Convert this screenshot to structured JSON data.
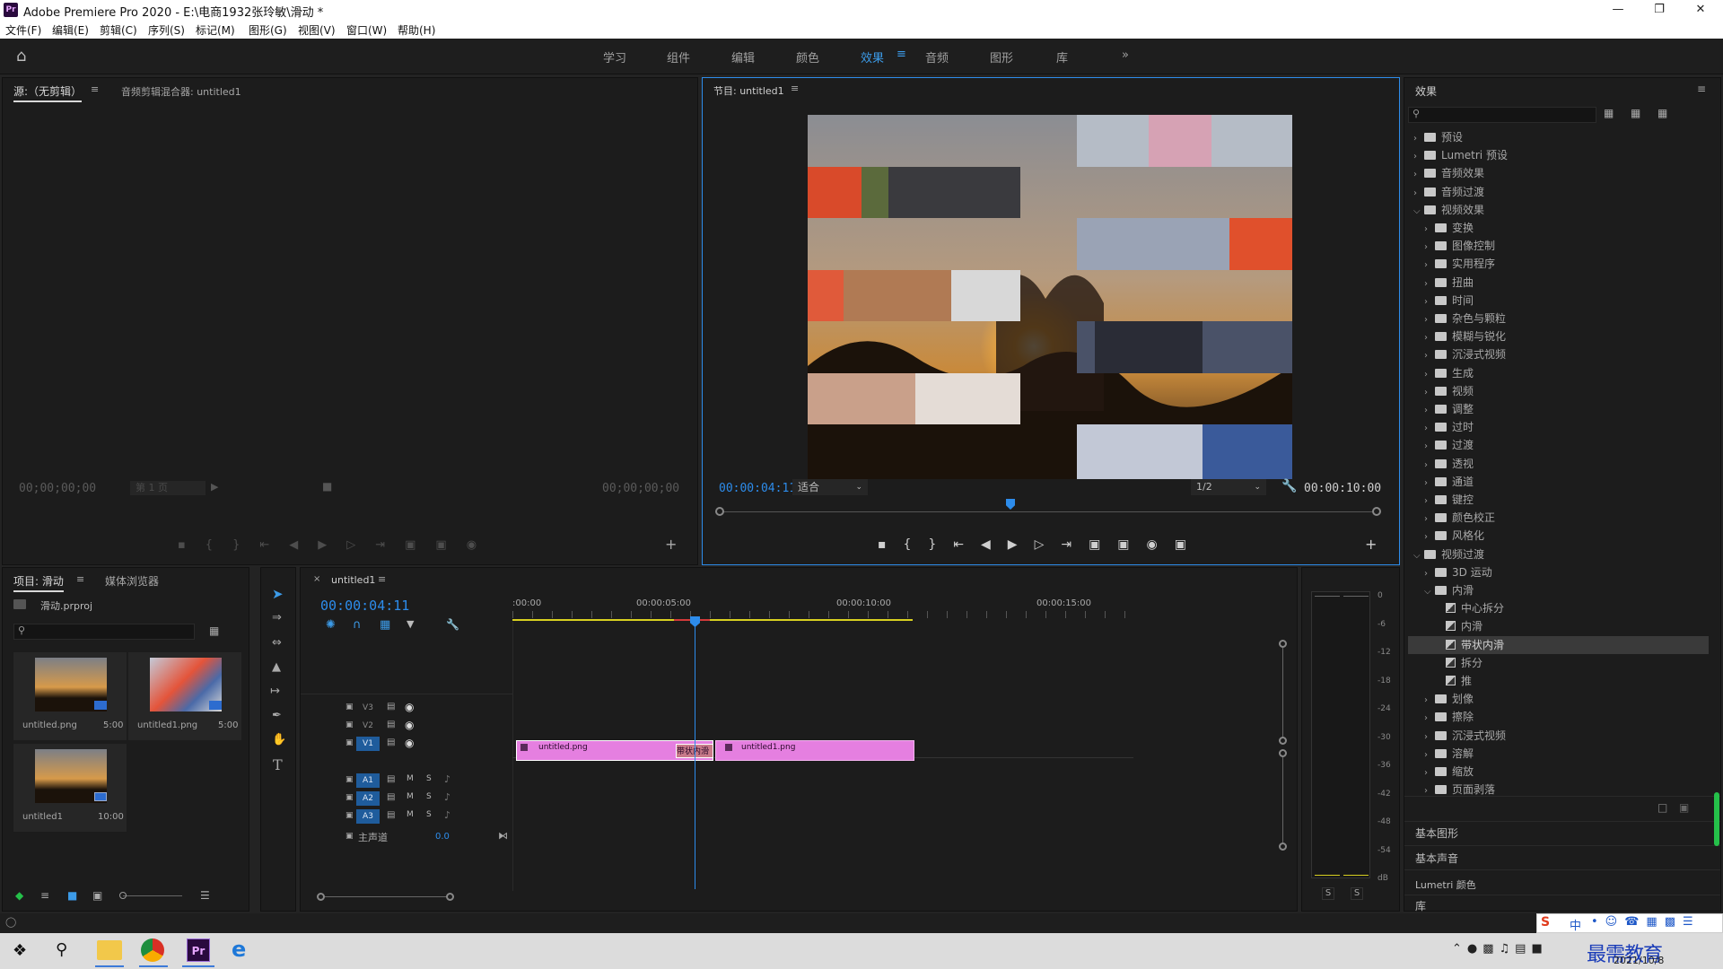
{
  "app": {
    "logo": "Pr",
    "title": "Adobe Premiere Pro 2020 - E:\\电商1932张玲敏\\滑动 *",
    "menu": [
      "文件(F)",
      "编辑(E)",
      "剪辑(C)",
      "序列(S)",
      "标记(M)",
      "图形(G)",
      "视图(V)",
      "窗口(W)",
      "帮助(H)"
    ],
    "window_controls": [
      "minimize-icon",
      "maximize-icon",
      "close-icon"
    ]
  },
  "workspaces": {
    "tabs": [
      "学习",
      "组件",
      "编辑",
      "颜色",
      "效果",
      "音频",
      "图形",
      "库"
    ],
    "active": "效果",
    "more": "»"
  },
  "source_panel": {
    "tab_source": "源:（无剪辑）",
    "tab_mixer": "音频剪辑混合器: untitled1",
    "timecode_in": "00;00;00;00",
    "timecode_out": "00;00;00;00",
    "page_select": "第 1 页"
  },
  "program_panel": {
    "title": "节目: untitled1",
    "timecode": "00:00:04:11",
    "fit": "适合",
    "resolution": "1/2",
    "duration": "00:00:10:00",
    "playhead_fraction": 0.441
  },
  "effects_panel": {
    "title": "效果",
    "search_placeholder": "",
    "tree": [
      {
        "label": "预设",
        "level": 0,
        "type": "folder",
        "open": false
      },
      {
        "label": "Lumetri 预设",
        "level": 0,
        "type": "folder",
        "open": false
      },
      {
        "label": "音频效果",
        "level": 0,
        "type": "folder",
        "open": false
      },
      {
        "label": "音频过渡",
        "level": 0,
        "type": "folder",
        "open": false
      },
      {
        "label": "视频效果",
        "level": 0,
        "type": "folder",
        "open": true
      },
      {
        "label": "变换",
        "level": 1,
        "type": "folder",
        "open": false
      },
      {
        "label": "图像控制",
        "level": 1,
        "type": "folder",
        "open": false
      },
      {
        "label": "实用程序",
        "level": 1,
        "type": "folder",
        "open": false
      },
      {
        "label": "扭曲",
        "level": 1,
        "type": "folder",
        "open": false
      },
      {
        "label": "时间",
        "level": 1,
        "type": "folder",
        "open": false
      },
      {
        "label": "杂色与颗粒",
        "level": 1,
        "type": "folder",
        "open": false
      },
      {
        "label": "模糊与锐化",
        "level": 1,
        "type": "folder",
        "open": false
      },
      {
        "label": "沉浸式视频",
        "level": 1,
        "type": "folder",
        "open": false
      },
      {
        "label": "生成",
        "level": 1,
        "type": "folder",
        "open": false
      },
      {
        "label": "视频",
        "level": 1,
        "type": "folder",
        "open": false
      },
      {
        "label": "调整",
        "level": 1,
        "type": "folder",
        "open": false
      },
      {
        "label": "过时",
        "level": 1,
        "type": "folder",
        "open": false
      },
      {
        "label": "过渡",
        "level": 1,
        "type": "folder",
        "open": false
      },
      {
        "label": "透视",
        "level": 1,
        "type": "folder",
        "open": false
      },
      {
        "label": "通道",
        "level": 1,
        "type": "folder",
        "open": false
      },
      {
        "label": "键控",
        "level": 1,
        "type": "folder",
        "open": false
      },
      {
        "label": "颜色校正",
        "level": 1,
        "type": "folder",
        "open": false
      },
      {
        "label": "风格化",
        "level": 1,
        "type": "folder",
        "open": false
      },
      {
        "label": "视频过渡",
        "level": 0,
        "type": "folder",
        "open": true
      },
      {
        "label": "3D 运动",
        "level": 1,
        "type": "folder",
        "open": false
      },
      {
        "label": "内滑",
        "level": 1,
        "type": "folder",
        "open": true
      },
      {
        "label": "中心拆分",
        "level": 2,
        "type": "effect"
      },
      {
        "label": "内滑",
        "level": 2,
        "type": "effect"
      },
      {
        "label": "带状内滑",
        "level": 2,
        "type": "effect",
        "selected": true
      },
      {
        "label": "拆分",
        "level": 2,
        "type": "effect"
      },
      {
        "label": "推",
        "level": 2,
        "type": "effect"
      },
      {
        "label": "划像",
        "level": 1,
        "type": "folder",
        "open": false
      },
      {
        "label": "擦除",
        "level": 1,
        "type": "folder",
        "open": false
      },
      {
        "label": "沉浸式视频",
        "level": 1,
        "type": "folder",
        "open": false
      },
      {
        "label": "溶解",
        "level": 1,
        "type": "folder",
        "open": false
      },
      {
        "label": "缩放",
        "level": 1,
        "type": "folder",
        "open": false
      },
      {
        "label": "页面剥落",
        "level": 1,
        "type": "folder",
        "open": false
      }
    ],
    "sections": [
      "基本图形",
      "基本声音",
      "Lumetri 颜色",
      "库"
    ]
  },
  "project_panel": {
    "tab_project": "项目: 滑动",
    "tab_media": "媒体浏览器",
    "file": "滑动.prproj",
    "items": [
      {
        "name": "untitled.png",
        "duration": "5:00"
      },
      {
        "name": "untitled1.png",
        "duration": "5:00"
      },
      {
        "name": "untitled1",
        "duration": "10:00"
      }
    ]
  },
  "timeline": {
    "tab": "untitled1",
    "timecode": "00:00:04:11",
    "ruler": [
      ":00:00",
      "00:00:05:00",
      "00:00:10:00",
      "00:00:15:00"
    ],
    "video_tracks": [
      "V3",
      "V2",
      "V1"
    ],
    "audio_tracks": [
      "A1",
      "A2",
      "A3"
    ],
    "master_label": "主声道",
    "master_value": "0.0",
    "track_buttons": {
      "mute": "M",
      "solo": "S"
    },
    "clips": [
      {
        "name": "untitled.png",
        "track": "V1"
      },
      {
        "name": "untitled1.png",
        "track": "V1"
      }
    ],
    "transition": "带状内滑",
    "playhead_seconds": 4.37
  },
  "audio_meter": {
    "scale": [
      "0",
      "-6",
      "-12",
      "-18",
      "-24",
      "-30",
      "-36",
      "-42",
      "-48",
      "-54",
      "dB"
    ],
    "buttons": [
      "S",
      "S"
    ]
  },
  "taskbar": {
    "ime": "中",
    "watermark": "最需教育",
    "date": "2021/10/8"
  }
}
